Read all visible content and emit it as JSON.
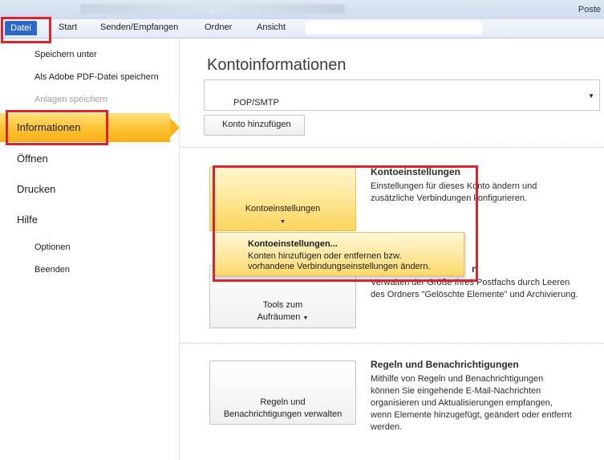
{
  "window": {
    "app_title": "Poste"
  },
  "tabs": [
    {
      "label": "Datei"
    },
    {
      "label": "Start"
    },
    {
      "label": "Senden/Empfangen"
    },
    {
      "label": "Ordner"
    },
    {
      "label": "Ansicht"
    }
  ],
  "leftnav": {
    "sub_top": [
      {
        "label": "Speichern unter"
      },
      {
        "label": "Als Adobe PDF-Datei speichern"
      },
      {
        "label": "Anlagen speichern"
      }
    ],
    "selected": "Informationen",
    "main": [
      {
        "label": "Öffnen"
      },
      {
        "label": "Drucken"
      },
      {
        "label": "Hilfe"
      }
    ],
    "sub_bottom": [
      {
        "label": "Optionen"
      },
      {
        "label": "Beenden"
      }
    ]
  },
  "main": {
    "title": "Kontoinformationen",
    "account_select_value": "POP/SMTP",
    "add_account_label": "Konto hinzufügen",
    "sections": [
      {
        "button": "Kontoeinstellungen",
        "title": "Kontoeinstellungen",
        "desc_line1": "Einstellungen für dieses Konto ändern und",
        "desc_line2": "zusätzliche Verbindungen konfigurieren."
      },
      {
        "button_line1": "Tools zum",
        "button_line2": "Aufräumen",
        "title_fragment": "n",
        "desc_line1": "Verwalten der Größe Ihres Postfachs durch Leeren",
        "desc_line2": "des Ordners \"Gelöschte Elemente\" und Archivierung."
      },
      {
        "button_line1": "Regeln und",
        "button_line2": "Benachrichtigungen verwalten",
        "title": "Regeln und Benachrichtigungen",
        "desc_line1": "Mithilfe von Regeln und Benachrichtigungen",
        "desc_line2": "können Sie eingehende E-Mail-Nachrichten",
        "desc_line3": "organisieren und Aktualisierungen empfangen,",
        "desc_line4": "wenn Elemente hinzugefügt, geändert oder entfernt",
        "desc_line5": "werden."
      }
    ],
    "dropdown": {
      "title": "Kontoeinstellungen...",
      "desc_line1": "Konten hinzufügen oder entfernen bzw.",
      "desc_line2": "vorhandene Verbindungseinstellungen ändern."
    }
  },
  "colors": {
    "highlight": "#e0202a",
    "selected_nav": "#fcc230",
    "file_tab": "#2b69c4"
  }
}
